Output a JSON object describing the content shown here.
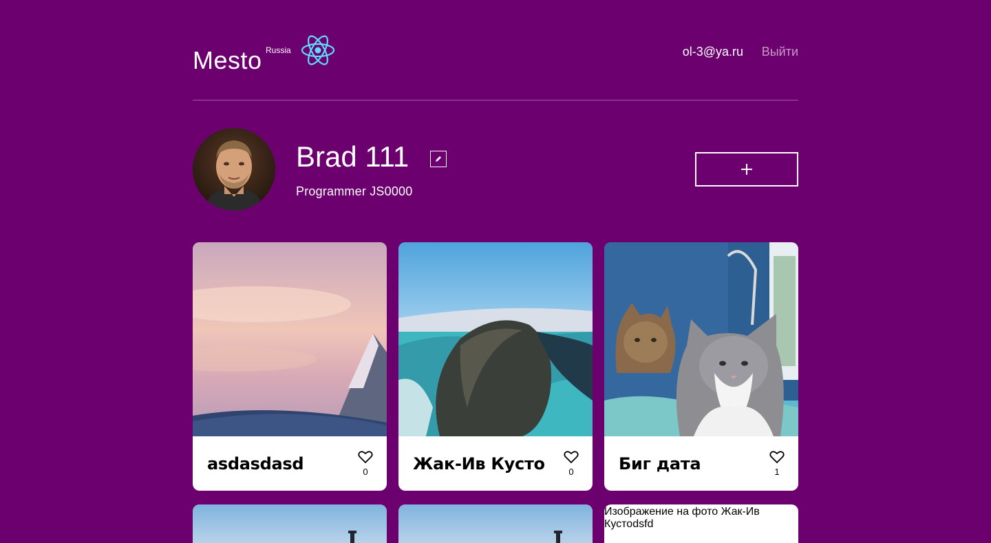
{
  "header": {
    "logo": "Mesto",
    "logo_sub": "Russia",
    "email": "ol-3@ya.ru",
    "logout": "Выйти"
  },
  "profile": {
    "name": "Brad 111",
    "about": "Programmer JS0000",
    "add_icon": "plus-icon",
    "edit_icon": "pencil-icon"
  },
  "cards": [
    {
      "title": "asdasdasd",
      "likes": "0",
      "image": "mountain-sunset"
    },
    {
      "title": "Жак-Ив Кусто",
      "likes": "0",
      "image": "rocky-cliff-lake"
    },
    {
      "title": "Биг дата",
      "likes": "1",
      "image": "cats"
    },
    {
      "title": "",
      "likes": "",
      "image": "sky-tower"
    },
    {
      "title": "",
      "likes": "",
      "image": "sky-tower"
    },
    {
      "title": "",
      "likes": "",
      "image": "broken",
      "alt": "Изображение на фото Жак-Ив Кустоdsfd"
    }
  ],
  "colors": {
    "background": "#6d006f",
    "react_logo": "#61dafb"
  }
}
